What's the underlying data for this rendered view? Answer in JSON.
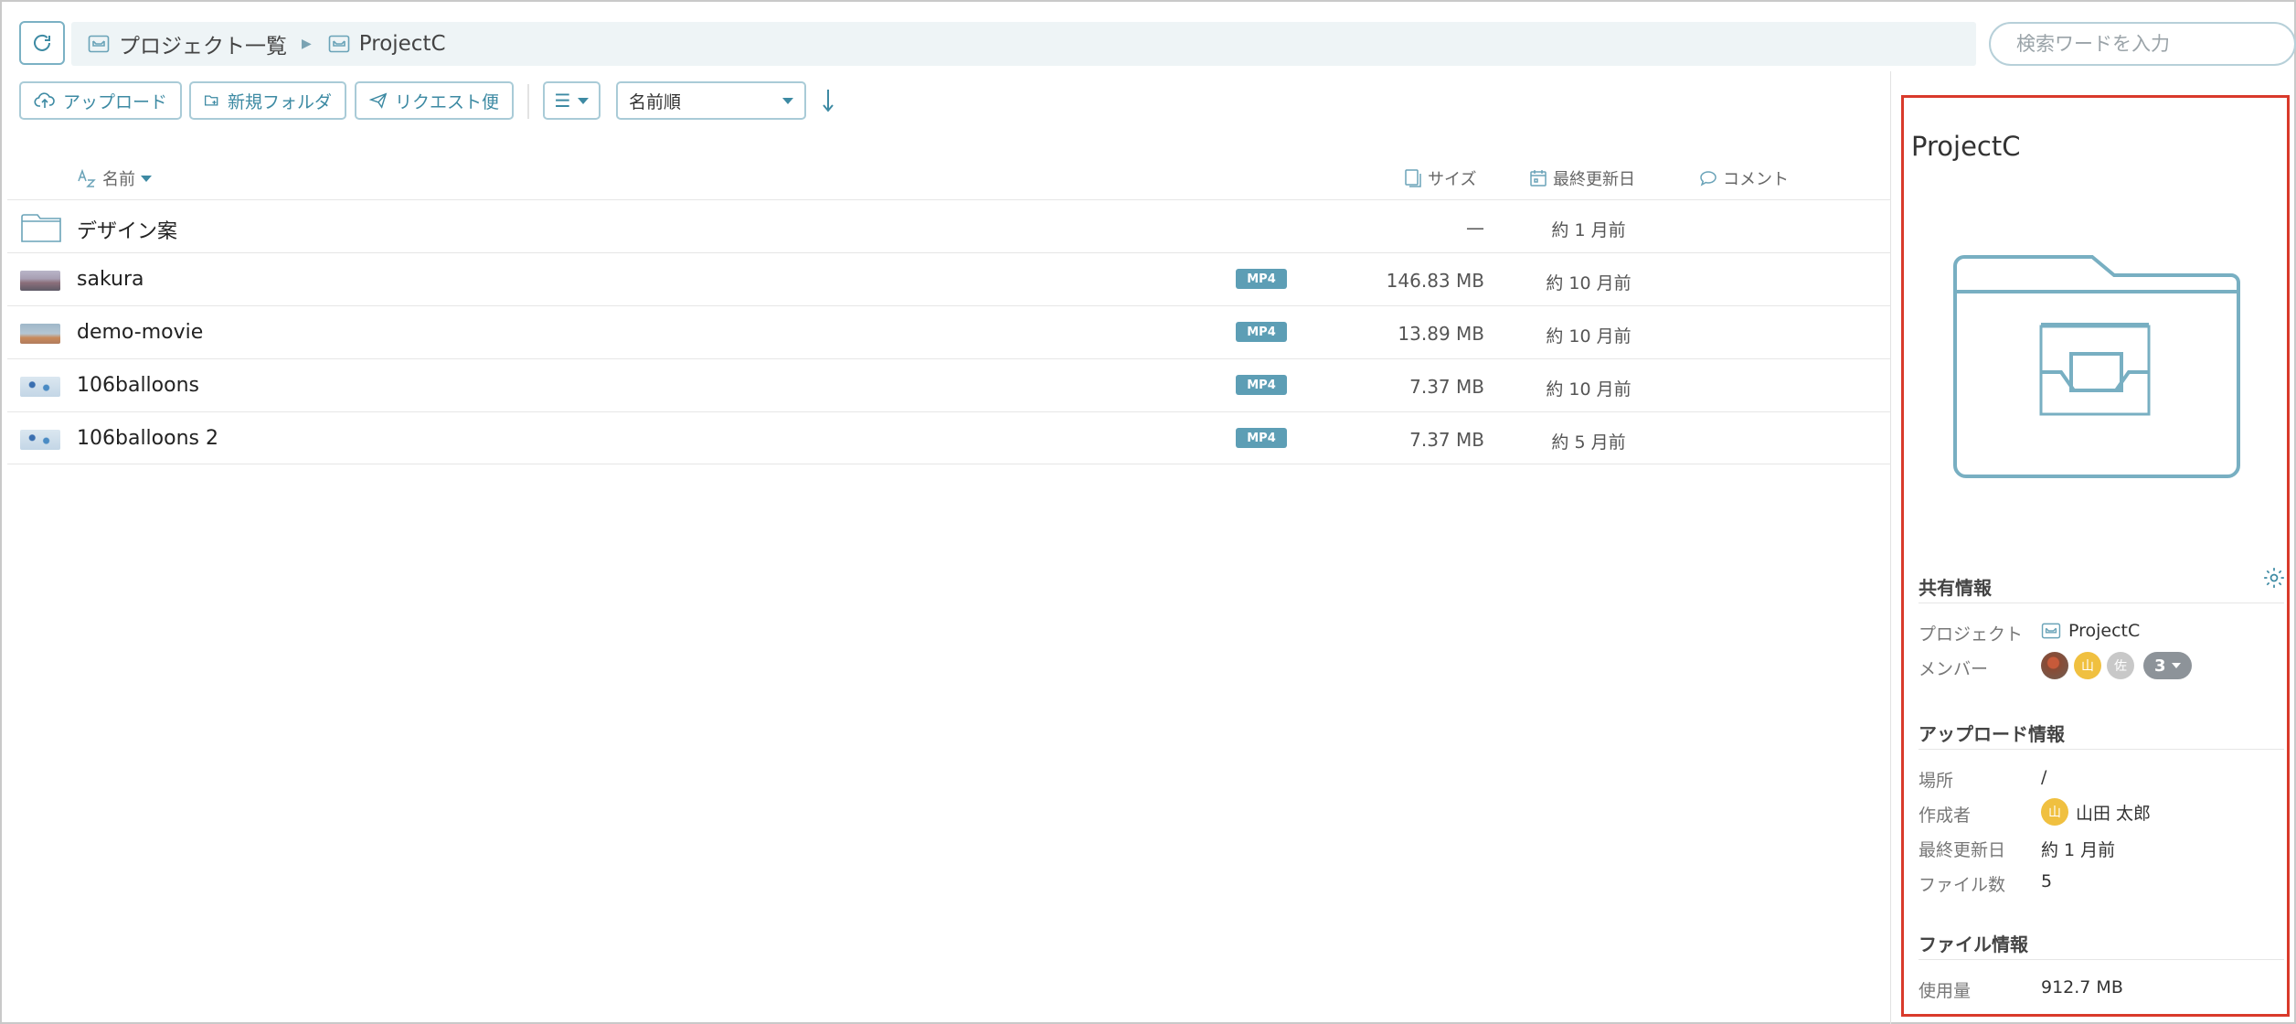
{
  "breadcrumb": {
    "items": [
      {
        "label": "プロジェクト一覧"
      },
      {
        "label": "ProjectC"
      }
    ]
  },
  "search": {
    "placeholder": "検索ワードを入力",
    "value": ""
  },
  "toolbar": {
    "upload_label": "アップロード",
    "new_folder_label": "新規フォルダ",
    "request_label": "リクエスト便",
    "view_icon": "list-icon",
    "sort_selected": "名前順",
    "sort_direction_icon": "arrow-down-icon"
  },
  "columns": {
    "name": "名前",
    "size": "サイズ",
    "modified": "最終更新日",
    "comment": "コメント"
  },
  "files": [
    {
      "name": "デザイン案",
      "type": "folder",
      "badge": "",
      "size": "—",
      "modified": "約 1 月前"
    },
    {
      "name": "sakura",
      "type": "video",
      "badge": "MP4",
      "size": "146.83 MB",
      "modified": "約 10 月前"
    },
    {
      "name": "demo-movie",
      "type": "video",
      "badge": "MP4",
      "size": "13.89 MB",
      "modified": "約 10 月前"
    },
    {
      "name": "106balloons",
      "type": "video",
      "badge": "MP4",
      "size": "7.37 MB",
      "modified": "約 10 月前"
    },
    {
      "name": "106balloons 2",
      "type": "video",
      "badge": "MP4",
      "size": "7.37 MB",
      "modified": "約 5 月前"
    }
  ],
  "detail": {
    "title": "ProjectC",
    "sharing": {
      "title": "共有情報",
      "project_label": "プロジェクト",
      "project_value": "ProjectC",
      "members_label": "メンバー",
      "members": [
        {
          "initial": "",
          "color": "#a0523d"
        },
        {
          "initial": "山",
          "color": "#f0c040"
        },
        {
          "initial": "佐",
          "color": "#c8c8c8"
        }
      ],
      "more_count": "3"
    },
    "upload": {
      "title": "アップロード情報",
      "location_label": "場所",
      "location_value": "/",
      "creator_label": "作成者",
      "creator_initial": "山",
      "creator_value": "山田 太郎",
      "modified_label": "最終更新日",
      "modified_value": "約 1 月前",
      "file_count_label": "ファイル数",
      "file_count_value": "5"
    },
    "file_info": {
      "title": "ファイル情報",
      "usage_label": "使用量",
      "usage_value": "912.7 MB"
    }
  },
  "colors": {
    "accent": "#3d8aa3",
    "badge": "#5d9eb5",
    "highlight_border": "#d93a2b"
  }
}
